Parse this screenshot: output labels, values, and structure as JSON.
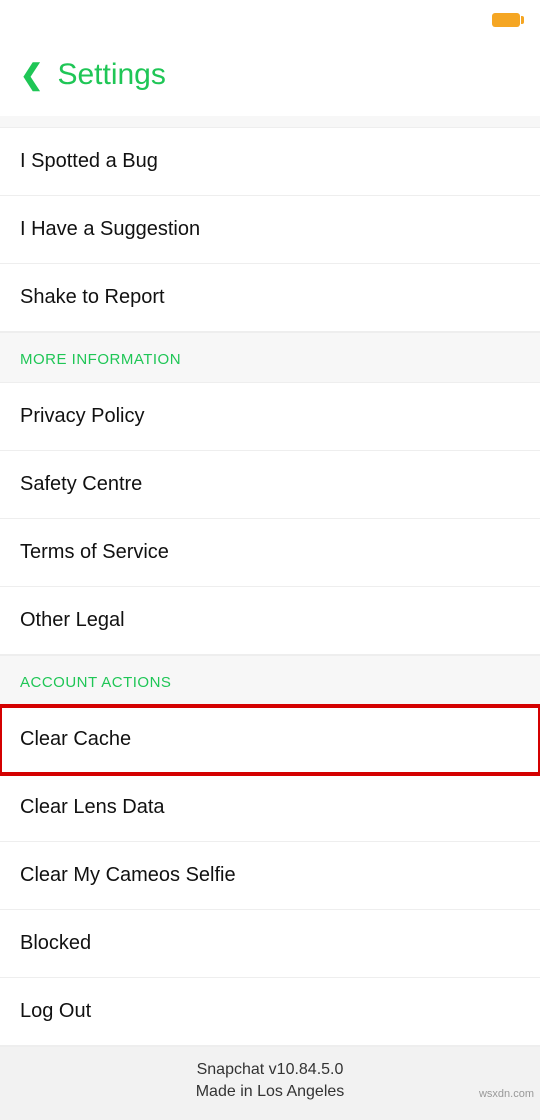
{
  "header": {
    "title": "Settings"
  },
  "sections": {
    "feedback": {
      "items": [
        "I Spotted a Bug",
        "I Have a Suggestion",
        "Shake to Report"
      ]
    },
    "more_info": {
      "title": "MORE INFORMATION",
      "items": [
        "Privacy Policy",
        "Safety Centre",
        "Terms of Service",
        "Other Legal"
      ]
    },
    "account_actions": {
      "title": "ACCOUNT ACTIONS",
      "items": [
        "Clear Cache",
        "Clear Lens Data",
        "Clear My Cameos Selfie",
        "Blocked",
        "Log Out"
      ]
    }
  },
  "footer": {
    "version": "Snapchat v10.84.5.0",
    "location": "Made in Los Angeles"
  },
  "watermark": "wsxdn.com"
}
